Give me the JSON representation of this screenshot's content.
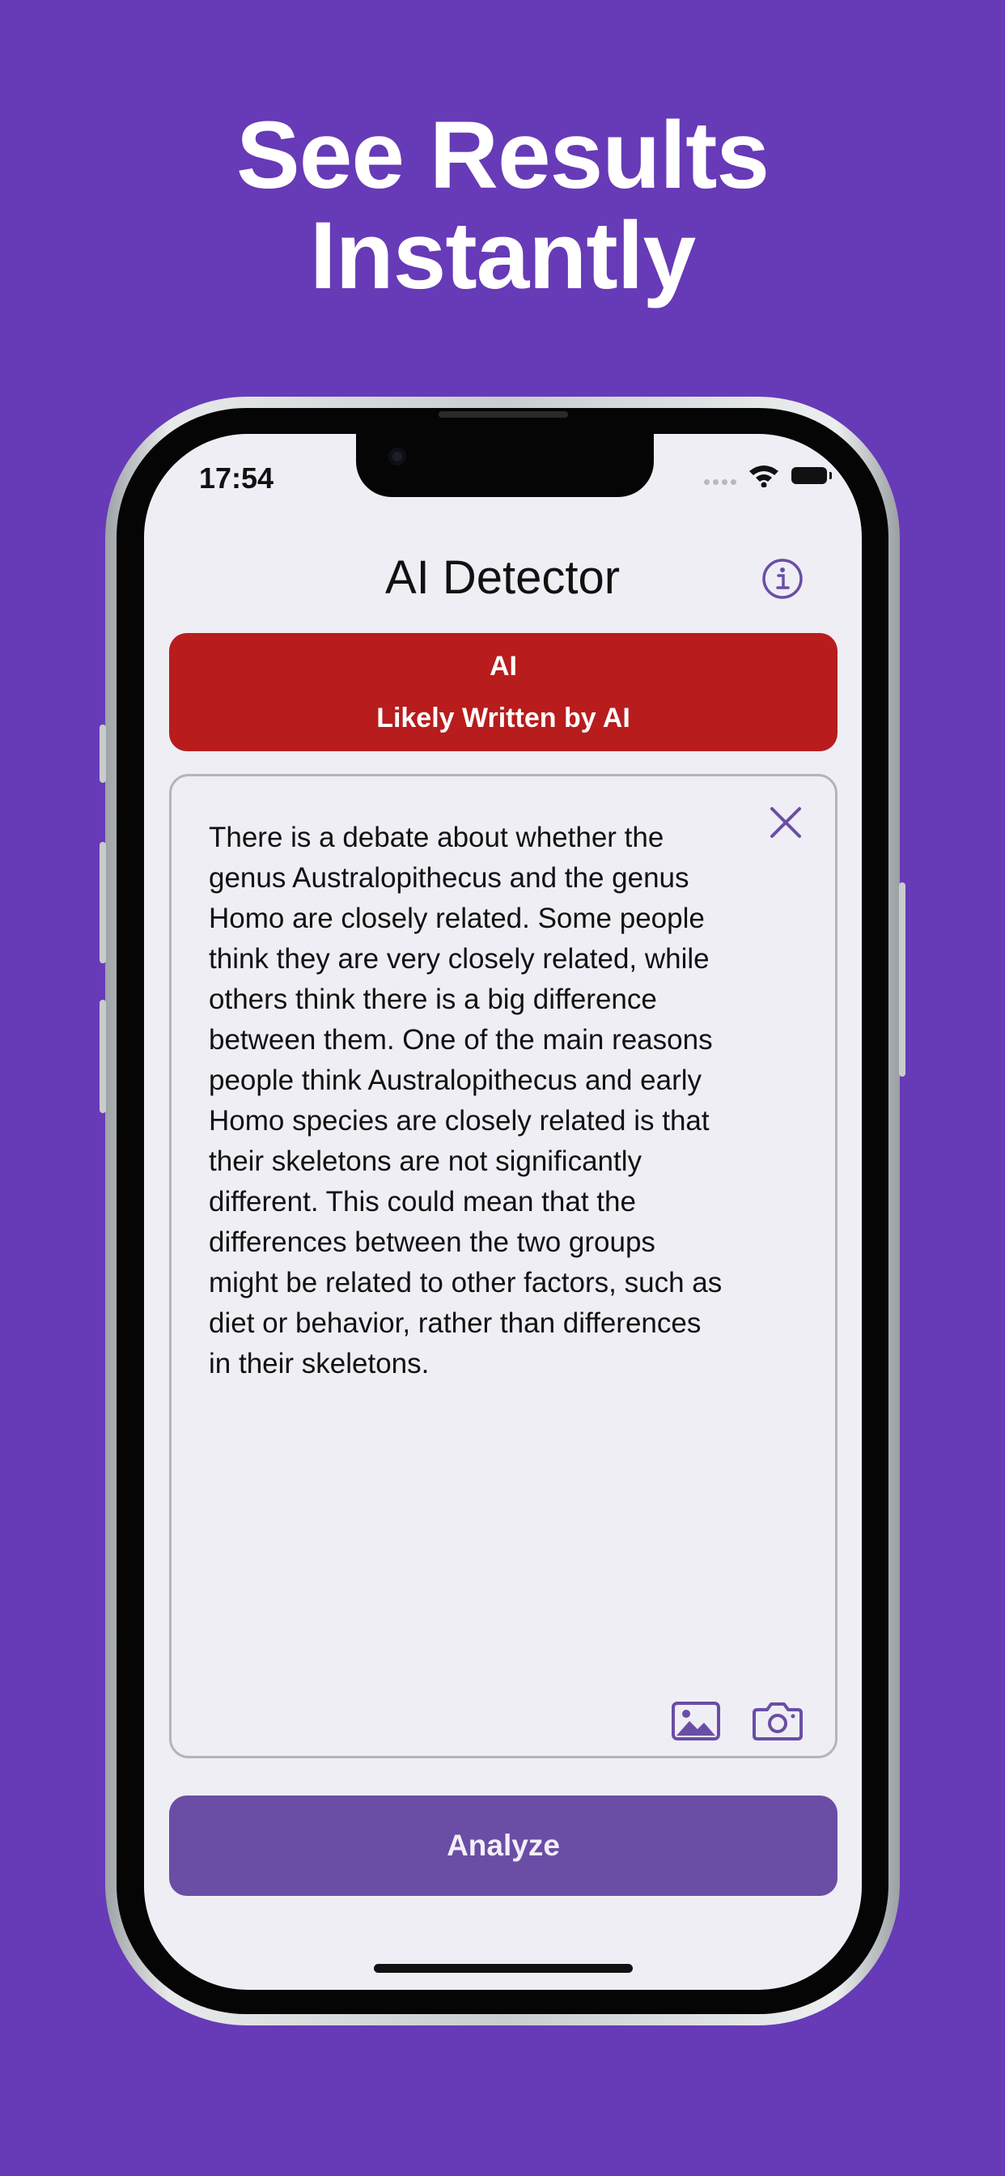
{
  "marketing": {
    "headline_line1": "See Results",
    "headline_line2": "Instantly"
  },
  "status_bar": {
    "time": "17:54"
  },
  "nav": {
    "title": "AI Detector",
    "info_icon": "info-circle-icon"
  },
  "result": {
    "label": "AI",
    "description": "Likely Written by AI",
    "color": "#b81c1c"
  },
  "editor": {
    "text": "There is a debate about whether the\ngenus Australopithecus and the genus\nHomo are closely related. Some people\nthink they are very closely related, while\nothers think there is a big difference\nbetween them. One of the main reasons\npeople think Australopithecus and early\nHomo species are closely related is that\ntheir skeletons are not significantly\ndifferent. This could mean that the\ndifferences between the two groups\nmight be related to other factors, such as\ndiet or behavior, rather than differences\nin their skeletons.",
    "clear_icon": "close-icon",
    "photo_icon": "photo-icon",
    "camera_icon": "camera-icon"
  },
  "actions": {
    "analyze_label": "Analyze"
  },
  "colors": {
    "background": "#673ab7",
    "accent": "#6a4ea5"
  }
}
